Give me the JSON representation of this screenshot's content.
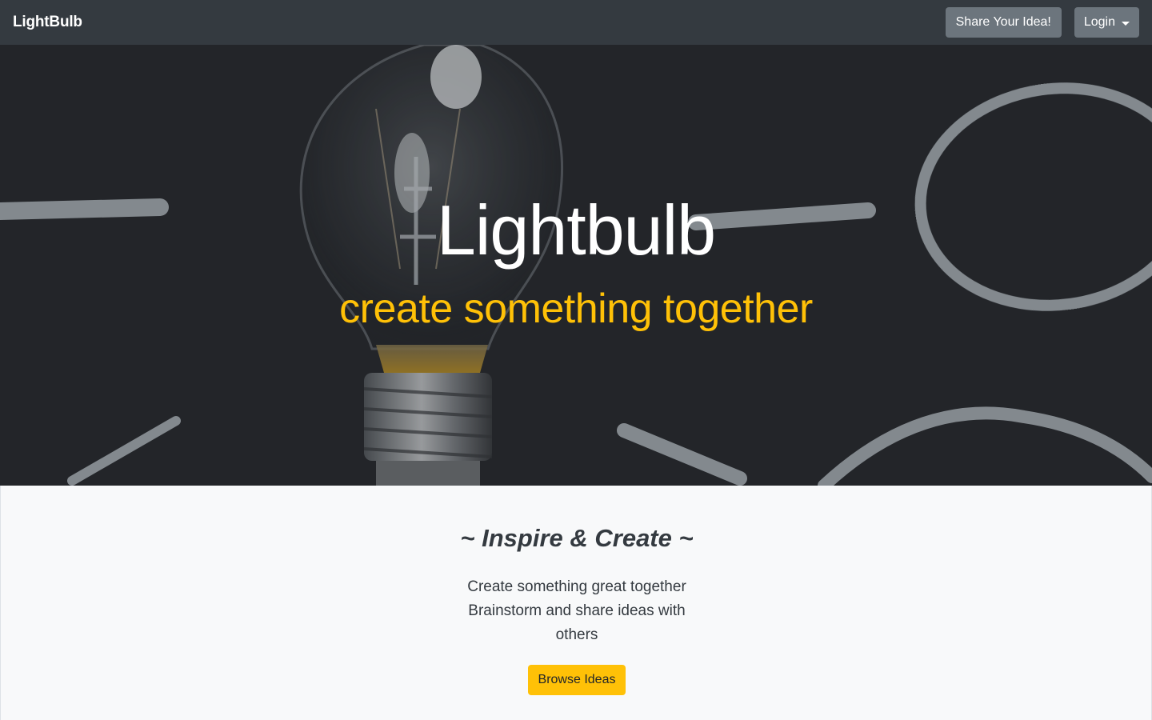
{
  "navbar": {
    "brand": "LightBulb",
    "share_label": "Share Your Idea!",
    "login_label": "Login"
  },
  "hero": {
    "title": "Lightbulb",
    "subtitle": "create something together"
  },
  "section": {
    "title": "~ Inspire & Create ~",
    "text_line1": "Create something great together",
    "text_line2": "Brainstorm and share ideas with others",
    "browse_label": "Browse Ideas"
  },
  "colors": {
    "navbar": "#343a40",
    "accent": "#ffc107",
    "secondary_button": "#6c757d",
    "background": "#f8f9fa"
  }
}
